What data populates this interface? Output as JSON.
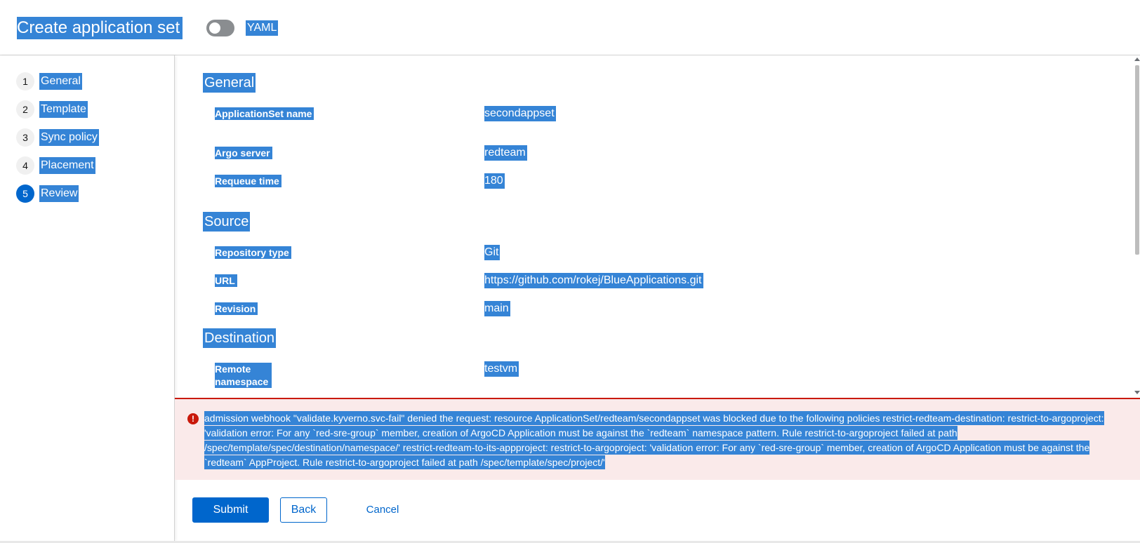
{
  "header": {
    "title": "Create application set",
    "yaml_toggle_label": "YAML"
  },
  "wizard_steps": [
    {
      "number": "1",
      "label": "General"
    },
    {
      "number": "2",
      "label": "Template"
    },
    {
      "number": "3",
      "label": "Sync policy"
    },
    {
      "number": "4",
      "label": "Placement"
    },
    {
      "number": "5",
      "label": "Review"
    }
  ],
  "review": {
    "general": {
      "title": "General",
      "items": [
        {
          "term": "ApplicationSet name",
          "value": "secondappset"
        },
        {
          "term": "Argo server",
          "value": "redteam"
        },
        {
          "term": "Requeue time",
          "value": "180"
        }
      ]
    },
    "source": {
      "title": "Source",
      "items": [
        {
          "term": "Repository type",
          "value": "Git"
        },
        {
          "term": "URL",
          "value": "https://github.com/rokej/BlueApplications.git"
        },
        {
          "term": "Revision",
          "value": "main"
        }
      ]
    },
    "destination": {
      "title": "Destination",
      "items": [
        {
          "term": "Remote namespace",
          "value": "testvm"
        }
      ]
    }
  },
  "alert": {
    "message": "admission webhook \"validate.kyverno.svc-fail\" denied the request: resource ApplicationSet/redteam/secondappset was blocked due to the following policies restrict-redteam-destination: restrict-to-argoproject: 'validation error: For any `red-sre-group` member, creation of ArgoCD Application must be against the `redteam` namespace pattern. Rule restrict-to-argoproject failed at path /spec/template/spec/destination/namespace/' restrict-redteam-to-its-appproject: restrict-to-argoproject: 'validation error: For any `red-sre-group` member, creation of ArgoCD Application must be against the `redteam` AppProject. Rule restrict-to-argoproject failed at path /spec/template/spec/project/'"
  },
  "footer": {
    "submit_label": "Submit",
    "back_label": "Back",
    "cancel_label": "Cancel"
  },
  "colors": {
    "primary": "#0066cc",
    "danger": "#c9190b",
    "selection": "#3584d6",
    "alert_bg": "#faeaea"
  }
}
